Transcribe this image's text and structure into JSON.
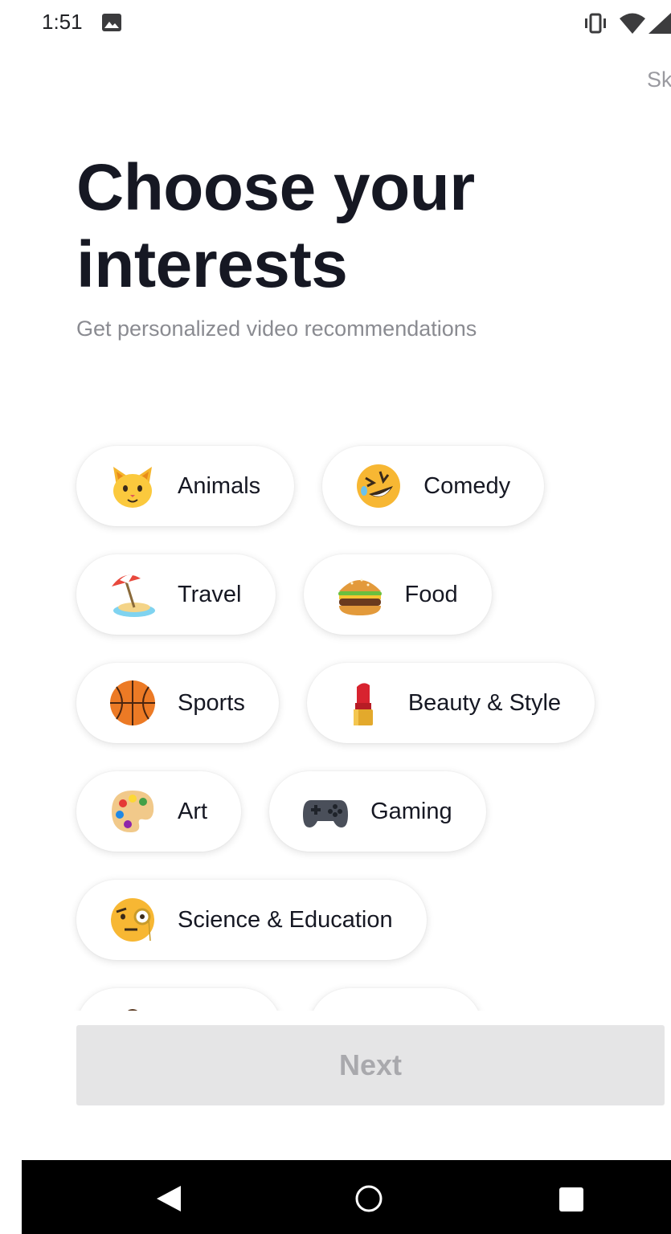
{
  "status_bar": {
    "time": "1:51",
    "icons": [
      "image-icon",
      "vibrate-icon",
      "wifi-icon",
      "signal-icon"
    ]
  },
  "header": {
    "skip_label": "Skip",
    "title": "Choose your interests",
    "subtitle": "Get personalized video recommendations"
  },
  "interests": [
    {
      "label": "Animals",
      "icon": "cat-face-icon"
    },
    {
      "label": "Comedy",
      "icon": "rolling-laughing-face-icon"
    },
    {
      "label": "Travel",
      "icon": "beach-umbrella-icon"
    },
    {
      "label": "Food",
      "icon": "hamburger-icon"
    },
    {
      "label": "Sports",
      "icon": "basketball-icon"
    },
    {
      "label": "Beauty & Style",
      "icon": "lipstick-icon"
    },
    {
      "label": "Art",
      "icon": "artist-palette-icon"
    },
    {
      "label": "Gaming",
      "icon": "game-controller-icon"
    },
    {
      "label": "Science & Education",
      "icon": "monocle-face-icon"
    }
  ],
  "footer": {
    "next_label": "Next",
    "next_enabled": false
  },
  "nav_bar": {
    "icons": [
      "back-icon",
      "home-icon",
      "recents-icon"
    ]
  },
  "colors": {
    "title": "#161823",
    "subtitle": "#8a8b91",
    "chip_bg": "#ffffff",
    "next_disabled_bg": "#e5e5e6",
    "next_disabled_text": "#a9a9ad",
    "nav_bar": "#000000"
  }
}
